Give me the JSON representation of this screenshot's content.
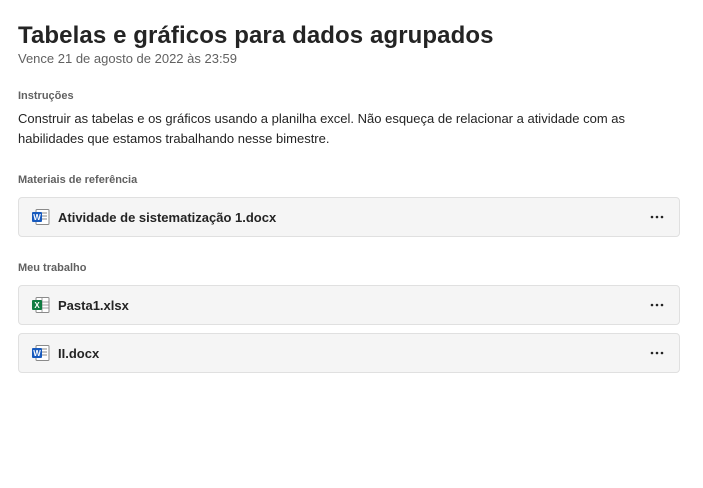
{
  "assignment": {
    "title": "Tabelas e gráficos para dados agrupados",
    "due": "Vence 21 de agosto de 2022 às 23:59"
  },
  "instructions": {
    "label": "Instruções",
    "text": "Construir as tabelas e os gráficos usando a planilha excel.  Não esqueça de relacionar a atividade com as habilidades que estamos trabalhando nesse bimestre."
  },
  "reference_materials": {
    "label": "Materiais de referência",
    "files": [
      {
        "name": "Atividade de sistematização 1.docx",
        "icon": "word-doc-icon"
      }
    ]
  },
  "my_work": {
    "label": "Meu trabalho",
    "files": [
      {
        "name": "Pasta1.xlsx",
        "icon": "excel-doc-icon"
      },
      {
        "name": "II.docx",
        "icon": "word-doc-icon"
      }
    ]
  },
  "colors": {
    "word_blue": "#185abd",
    "excel_green": "#107c41",
    "muted_text": "#616161",
    "card_background": "#f5f5f5"
  }
}
